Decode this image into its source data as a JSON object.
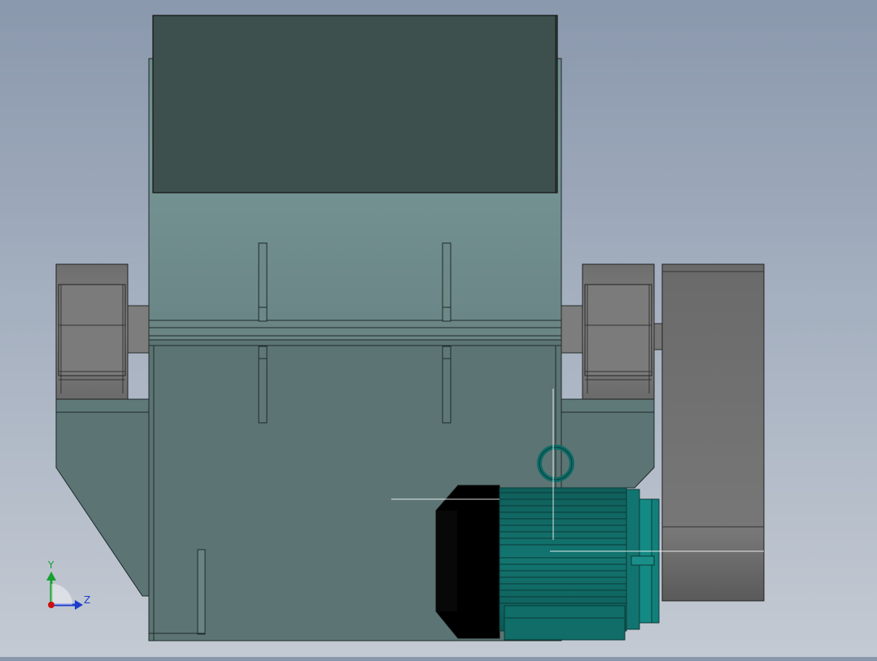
{
  "viewport": {
    "background_top": "#8a98ad",
    "background_bottom": "#c4cad3"
  },
  "model": {
    "hopper_color": "#3d504e",
    "upper_body_color": "#729090",
    "lower_body_color": "#5c7574",
    "bearing_color": "#7a7a7a",
    "motor_color": "#106d68",
    "motor_end_color": "#000000",
    "pulley_color": "#747474"
  },
  "triad": {
    "y_label": "Y",
    "z_label": "Z",
    "y_color": "#18a030",
    "z_color": "#1c3ccc",
    "origin_color": "#cc1010"
  }
}
